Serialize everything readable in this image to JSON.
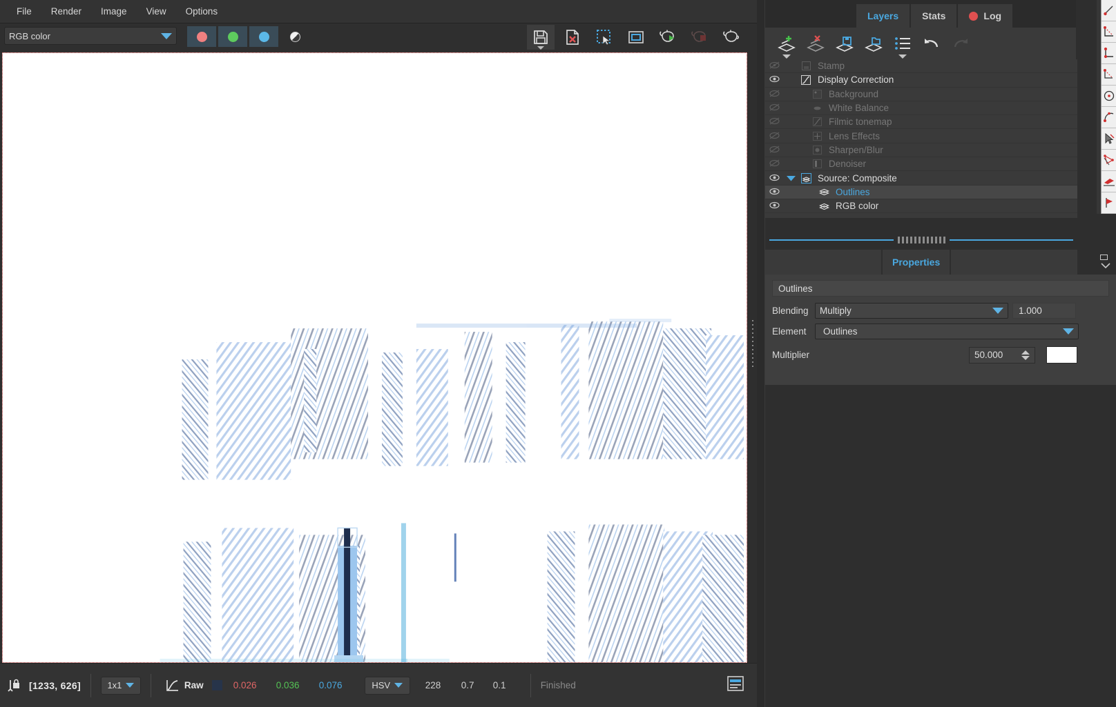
{
  "app": {
    "menu": [
      {
        "label": "File",
        "name": "menu-file"
      },
      {
        "label": "Render",
        "name": "menu-render"
      },
      {
        "label": "Image",
        "name": "menu-image"
      },
      {
        "label": "View",
        "name": "menu-view"
      },
      {
        "label": "Options",
        "name": "menu-options"
      }
    ]
  },
  "toolbar": {
    "layer_select_value": "RGB color",
    "channel_buttons": [
      {
        "name": "channel-red-button",
        "color": "#f08080"
      },
      {
        "name": "channel-green-button",
        "color": "#5ecb5e"
      },
      {
        "name": "channel-blue-button",
        "color": "#5bb8e8"
      }
    ],
    "alpha_button": "alpha-channel-icon",
    "icons": [
      {
        "name": "save-image-button",
        "label": "save-icon"
      },
      {
        "name": "discard-image-button",
        "label": "delete-image-icon"
      },
      {
        "name": "region-select-button",
        "label": "marquee-select-icon"
      },
      {
        "name": "render-region-button",
        "label": "frame-region-icon"
      },
      {
        "name": "start-render-button",
        "label": "teapot-play-icon"
      },
      {
        "name": "stop-render-button",
        "label": "teapot-stop-icon"
      },
      {
        "name": "teapot-button",
        "label": "teapot-icon"
      }
    ]
  },
  "canvas": {
    "description": "Rendered viewport image — white background with blue-tinted wireframe outline architectural render"
  },
  "statusbar": {
    "lock_icon": "pixel-probe-lock-icon",
    "coordinates": "[1233, 626]",
    "sample_size": "1x1",
    "curve_icon": "tone-curve-icon",
    "raw_label": "Raw",
    "raw_swatch": "#27344a",
    "raw_r": "0.026",
    "raw_g": "0.036",
    "raw_b": "0.076",
    "colorspace": "HSV",
    "hsv_h": "228",
    "hsv_s": "0.7",
    "hsv_v": "0.1",
    "status": "Finished",
    "log_icon": "log-panel-icon"
  },
  "right_panel": {
    "tabs": [
      {
        "label": "Layers",
        "name": "tab-layers",
        "selected": true,
        "has_record_dot": false
      },
      {
        "label": "Stats",
        "name": "tab-stats",
        "selected": false,
        "has_record_dot": false
      },
      {
        "label": "Log",
        "name": "tab-log",
        "selected": false,
        "has_record_dot": true
      }
    ],
    "layer_tools": [
      {
        "name": "add-layer-button",
        "label": "add-layer-icon"
      },
      {
        "name": "remove-layer-button",
        "label": "remove-layer-icon"
      },
      {
        "name": "save-layer-button",
        "label": "save-layer-icon"
      },
      {
        "name": "load-layer-button",
        "label": "load-layer-icon"
      },
      {
        "name": "layer-list-options-button",
        "label": "list-icon"
      },
      {
        "name": "undo-button",
        "label": "undo-icon"
      },
      {
        "name": "redo-button",
        "label": "redo-icon"
      }
    ],
    "layers": [
      {
        "label": "Stamp",
        "name": "layer-row-stamp",
        "visible": false,
        "dim": true,
        "indent": 0,
        "icon": "stamp-icon",
        "selected": false,
        "twisty": false
      },
      {
        "label": "Display Correction",
        "name": "layer-row-display-correction",
        "visible": true,
        "dim": false,
        "indent": 0,
        "icon": "curve-icon",
        "selected": false,
        "twisty": false
      },
      {
        "label": "Background",
        "name": "layer-row-background",
        "visible": false,
        "dim": true,
        "indent": 1,
        "icon": "background-icon",
        "selected": false,
        "twisty": false
      },
      {
        "label": "White Balance",
        "name": "layer-row-white-balance",
        "visible": false,
        "dim": true,
        "indent": 1,
        "icon": "white-balance-icon",
        "selected": false,
        "twisty": false
      },
      {
        "label": "Filmic tonemap",
        "name": "layer-row-filmic-tonemap",
        "visible": false,
        "dim": true,
        "indent": 1,
        "icon": "tonemap-icon",
        "selected": false,
        "twisty": false
      },
      {
        "label": "Lens Effects",
        "name": "layer-row-lens-effects",
        "visible": false,
        "dim": true,
        "indent": 1,
        "icon": "lens-icon",
        "selected": false,
        "twisty": false
      },
      {
        "label": "Sharpen/Blur",
        "name": "layer-row-sharpen-blur",
        "visible": false,
        "dim": true,
        "indent": 1,
        "icon": "sharpen-icon",
        "selected": false,
        "twisty": false
      },
      {
        "label": "Denoiser",
        "name": "layer-row-denoiser",
        "visible": false,
        "dim": true,
        "indent": 1,
        "icon": "denoiser-icon",
        "selected": false,
        "twisty": false
      },
      {
        "label": "Source: Composite",
        "name": "layer-row-source-composite",
        "visible": true,
        "dim": false,
        "indent": 0,
        "icon": "stack-icon",
        "selected": false,
        "twisty": true
      },
      {
        "label": "Outlines",
        "name": "layer-row-outlines",
        "visible": true,
        "dim": false,
        "indent": 2,
        "icon": "stack-icon",
        "selected": true,
        "twisty": false
      },
      {
        "label": "RGB color",
        "name": "layer-row-rgb-color",
        "visible": true,
        "dim": false,
        "indent": 2,
        "icon": "stack-icon",
        "selected": false,
        "twisty": false
      }
    ],
    "properties": {
      "tab_label": "Properties",
      "layer_name": "Outlines",
      "blending_label": "Blending",
      "blending_value": "Multiply",
      "blending_opacity": "1.000",
      "element_label": "Element",
      "element_value": "Outlines",
      "multiplier_label": "Multiplier",
      "multiplier_value": "50.000",
      "multiplier_color": "#ffffff"
    }
  },
  "vertical_palette": [
    {
      "name": "tool-point-icon"
    },
    {
      "name": "tool-angle-measure-icon"
    },
    {
      "name": "tool-distance-icon"
    },
    {
      "name": "tool-corner-icon"
    },
    {
      "name": "tool-circle-icon"
    },
    {
      "name": "tool-arc-icon"
    },
    {
      "name": "tool-cursor-icon"
    },
    {
      "name": "tool-node-edit-icon"
    },
    {
      "name": "tool-plane-icon"
    },
    {
      "name": "tool-flag-icon"
    }
  ],
  "colors": {
    "accent": "#4aa8e0",
    "panel_bg": "#3a3a3a",
    "window_bg": "#2e2e2e",
    "canvas_bg": "#ffffff"
  }
}
